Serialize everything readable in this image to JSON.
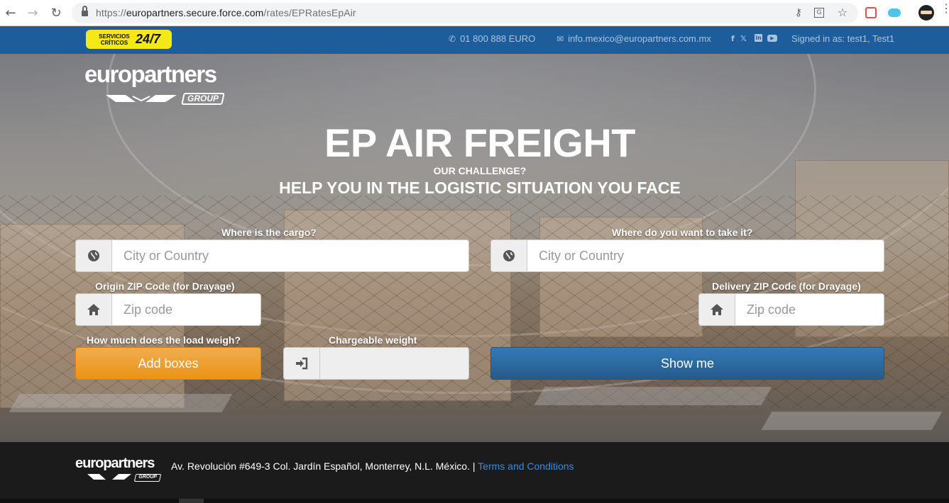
{
  "browser": {
    "url_prefix": "https://",
    "url_host": "europartners.secure.force.com",
    "url_path": "/rates/EPRatesEpAir",
    "icons": [
      "back-arrow-icon",
      "forward-arrow-icon",
      "reload-icon",
      "lock-icon",
      "key-icon",
      "translate-icon",
      "star-icon",
      "menu-icon"
    ]
  },
  "topbar": {
    "badge_small": "SERVICIOS CRÍTICOS",
    "badge_big": "24/7",
    "phone": "01 800 888 EURO",
    "email": "info.mexico@europartners.com.mx",
    "social": [
      "f",
      "t",
      "in",
      "yt"
    ],
    "signed_in": "Signed in as: test1, Test1",
    "color": "#1e5d9b"
  },
  "logo": {
    "wordmark": "europartners",
    "group": "GROUP"
  },
  "hero": {
    "title": "EP AIR FREIGHT",
    "subtitle_small": "OUR CHALLENGE?",
    "subtitle_big": "HELP YOU IN THE LOGISTIC SITUATION YOU FACE"
  },
  "form": {
    "origin_label": "Where is the cargo?",
    "origin_placeholder": "City or Country",
    "destination_label": "Where do you want to take it?",
    "destination_placeholder": "City or Country",
    "origin_zip_label": "Origin ZIP Code (for Drayage)",
    "origin_zip_placeholder": "Zip code",
    "delivery_zip_label": "Delivery ZIP Code (for Drayage)",
    "delivery_zip_placeholder": "Zip code",
    "weight_label": "How much does the load weigh?",
    "add_boxes_label": "Add boxes",
    "chargeable_label": "Chargeable weight",
    "chargeable_value": "",
    "show_me_label": "Show me",
    "orange": "#f0ad4e",
    "blue": "#337ab7"
  },
  "footer": {
    "wordmark": "europartners",
    "group": "GROUP",
    "address": "Av. Revolución #649-3 Col. Jardín Español, Monterrey, N.L. México. |",
    "terms_link": "Terms and Conditions"
  }
}
